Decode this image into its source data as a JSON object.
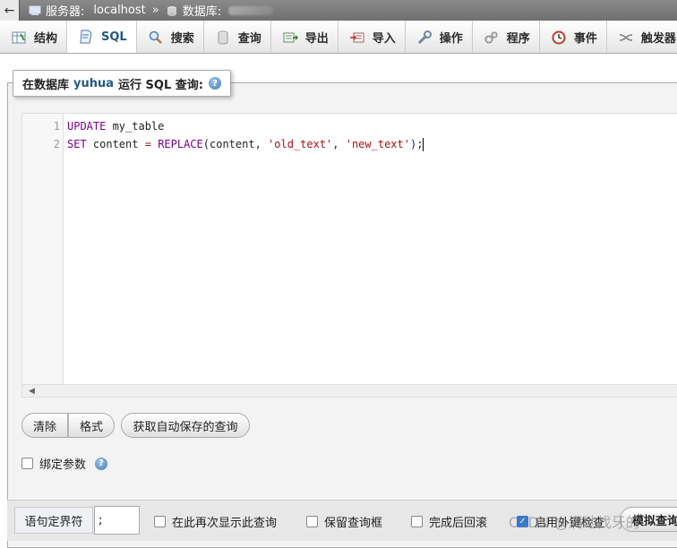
{
  "breadcrumb": {
    "server_label": "服务器:",
    "server_value": "localhost",
    "separator": "»",
    "database_label": "数据库:"
  },
  "tabs": [
    {
      "label": "结构",
      "icon": "structure-icon"
    },
    {
      "label": "SQL",
      "icon": "sql-icon",
      "active": true
    },
    {
      "label": "搜索",
      "icon": "search-icon"
    },
    {
      "label": "查询",
      "icon": "query-icon"
    },
    {
      "label": "导出",
      "icon": "export-icon"
    },
    {
      "label": "导入",
      "icon": "import-icon"
    },
    {
      "label": "操作",
      "icon": "operations-icon"
    },
    {
      "label": "程序",
      "icon": "routines-icon"
    },
    {
      "label": "事件",
      "icon": "events-icon"
    },
    {
      "label": "触发器",
      "icon": "triggers-icon"
    }
  ],
  "query_box": {
    "title_prefix": "在数据库",
    "database": "yuhua",
    "title_suffix": "运行 SQL 查询:"
  },
  "editor": {
    "line_numbers": [
      "1",
      "2"
    ]
  },
  "buttons": {
    "clear": "清除",
    "format": "格式",
    "get_autosaved": "获取自动保存的查询"
  },
  "bind_params": "绑定参数",
  "options": {
    "delimiter_label": "语句定界符",
    "delimiter_value": ";",
    "show_again": "在此再次显示此查询",
    "retain_box": "保留查询框",
    "rollback": "完成后回滚",
    "foreign_keys": "启用外键检查",
    "foreign_keys_checked": true,
    "simulate": "模拟查询"
  },
  "watermark": "CSDN @满地找牙的",
  "colors": {
    "tab_text": "#235a81",
    "keyword": "#770088",
    "string": "#aa1111"
  }
}
